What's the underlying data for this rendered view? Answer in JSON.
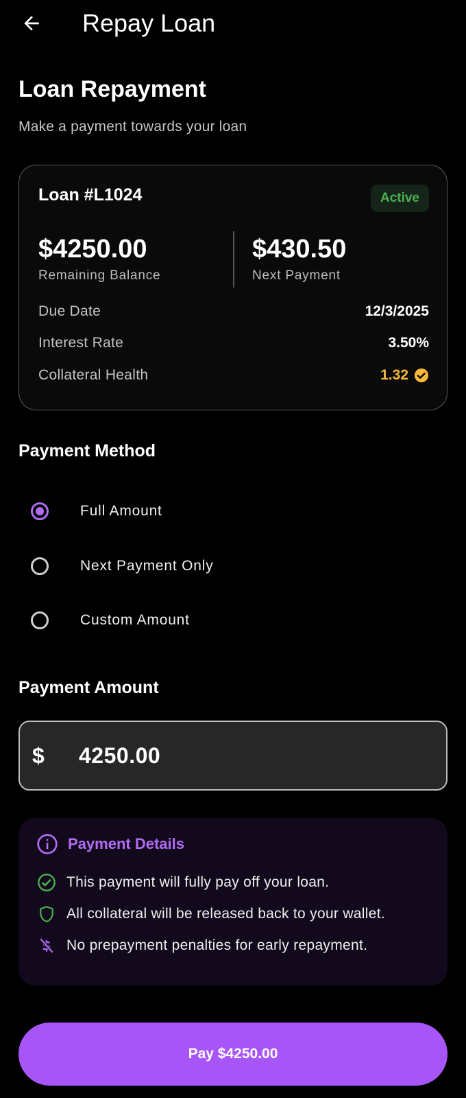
{
  "appbar": {
    "title": "Repay Loan",
    "back_icon": "arrow-left-icon"
  },
  "header": {
    "title": "Loan Repayment",
    "subtitle": "Make a payment towards your loan"
  },
  "loan": {
    "id": "Loan #L1024",
    "status": "Active",
    "remaining_balance": "$4250.00",
    "remaining_balance_label": "Remaining Balance",
    "next_payment": "$430.50",
    "next_payment_label": "Next Payment",
    "rows": [
      {
        "label": "Due Date",
        "value": "12/3/2025"
      },
      {
        "label": "Interest Rate",
        "value": "3.50%"
      },
      {
        "label": "Collateral Health",
        "value": "1.32",
        "icon": "check-circle-icon"
      }
    ]
  },
  "payment_method": {
    "title": "Payment Method",
    "options": [
      {
        "label": "Full Amount",
        "selected": true
      },
      {
        "label": "Next Payment Only",
        "selected": false
      },
      {
        "label": "Custom Amount",
        "selected": false
      }
    ]
  },
  "payment_amount": {
    "title": "Payment Amount",
    "prefix": "$",
    "value": "4250.00"
  },
  "payment_details": {
    "title": "Payment Details",
    "icon": "info-icon",
    "items": [
      {
        "icon": "check-circle-outline-icon",
        "text": "This payment will fully pay off your loan."
      },
      {
        "icon": "shield-icon",
        "text": "All collateral will be released back to your wallet."
      },
      {
        "icon": "money-off-icon",
        "text": "No prepayment penalties for early repayment."
      }
    ]
  },
  "pay_button": {
    "label": "Pay $4250.00"
  },
  "colors": {
    "accent": "#a855f7",
    "active": "#4caf50",
    "warning": "#f6b93b"
  }
}
